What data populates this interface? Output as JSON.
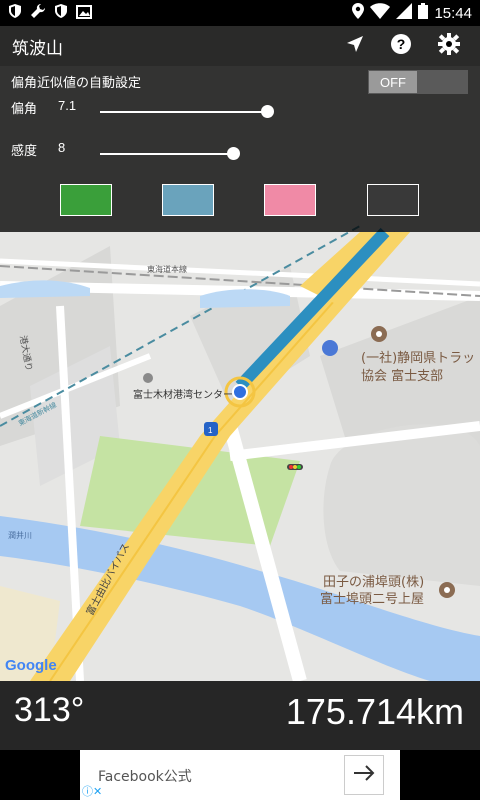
{
  "status_bar": {
    "time": "15:44"
  },
  "toolbar": {
    "title": "筑波山"
  },
  "panel": {
    "auto_label": "偏角近似値の自動設定",
    "toggle_off_label": "OFF",
    "declination": {
      "label": "偏角",
      "value": "7.1",
      "level": 0.98
    },
    "sensitivity": {
      "label": "感度",
      "value": "8",
      "level": 0.78
    },
    "swatches": [
      "#3a9f3a",
      "#6aa3bc",
      "#f08aa6",
      "#393939"
    ]
  },
  "map": {
    "labels": {
      "tokaido_main": "東海道本線",
      "minato_road": "港大通り",
      "tokaido_shinkansen": "東海道新幹線",
      "fuji_lumber": "富士木材港湾センター",
      "fuji_association_1": "(一社)静岡県トラッ",
      "fuji_association_2": "協会 富士支部",
      "route_number": "1",
      "fuji_bypass": "富士由比バイパス",
      "river": "潤井川",
      "taganoura_1": "田子の浦埠頭(株)",
      "taganoura_2": "富士埠頭二号上屋",
      "google": "Google"
    }
  },
  "bottom": {
    "bearing": "313°",
    "distance": "175.714km"
  },
  "ad": {
    "text": "Facebook公式"
  }
}
